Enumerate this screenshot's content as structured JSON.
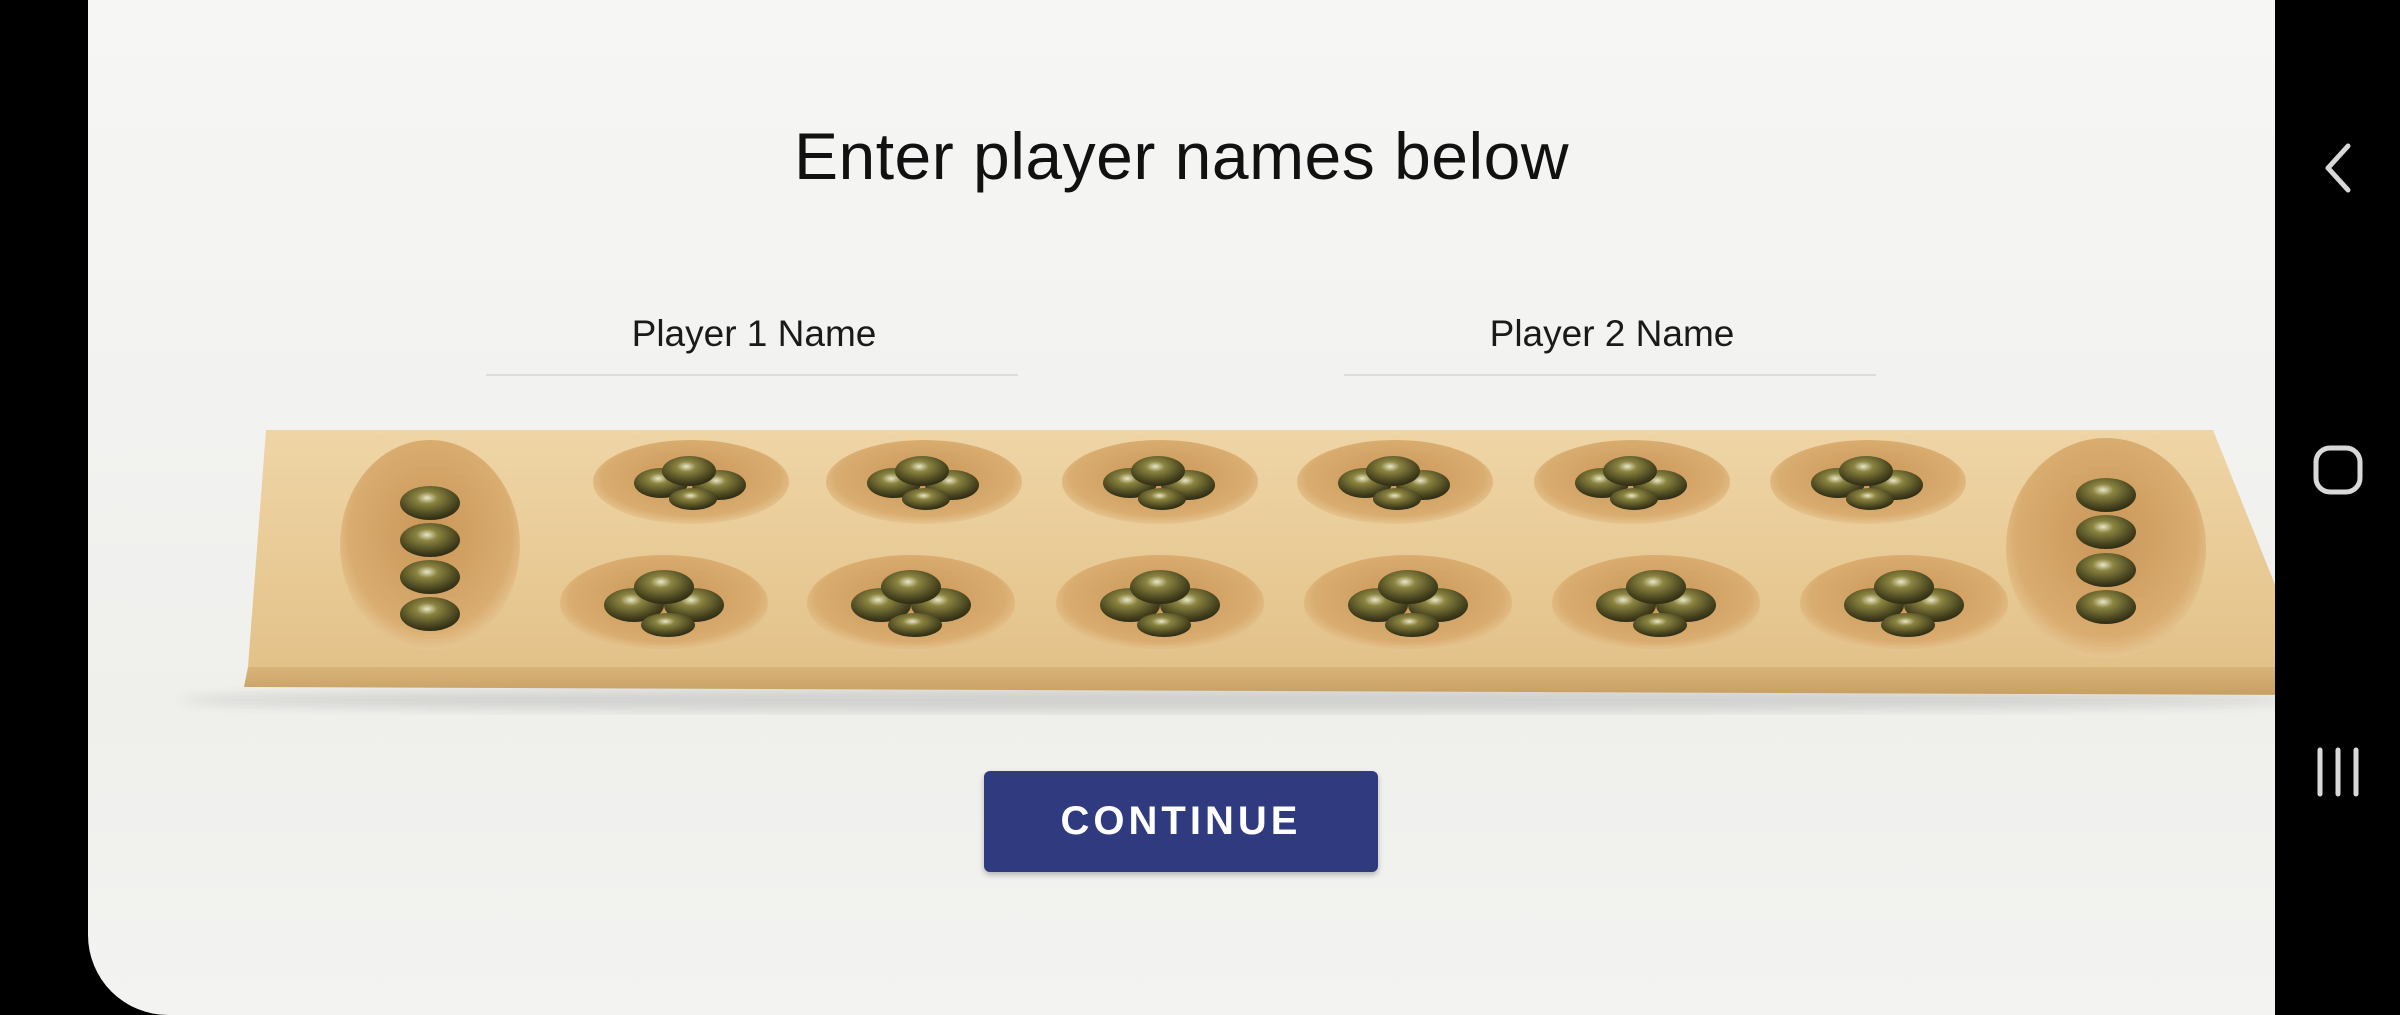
{
  "page": {
    "title": "Enter player names below"
  },
  "form": {
    "player1_placeholder": "Player 1 Name",
    "player1_value": "",
    "player2_placeholder": "Player 2 Name",
    "player2_value": "",
    "continue_label": "CONTINUE"
  },
  "board": {
    "pits_per_row": 6,
    "stores": 2
  },
  "navbar": {
    "items": [
      {
        "name": "back",
        "icon": "chevron-left-icon"
      },
      {
        "name": "home",
        "icon": "rounded-square-icon"
      },
      {
        "name": "recents",
        "icon": "three-bars-icon"
      }
    ]
  },
  "colors": {
    "accent": "#2f3b7e",
    "background": "#f3f3f1",
    "wood": "#e6c792",
    "stone": "#4f4a22"
  }
}
